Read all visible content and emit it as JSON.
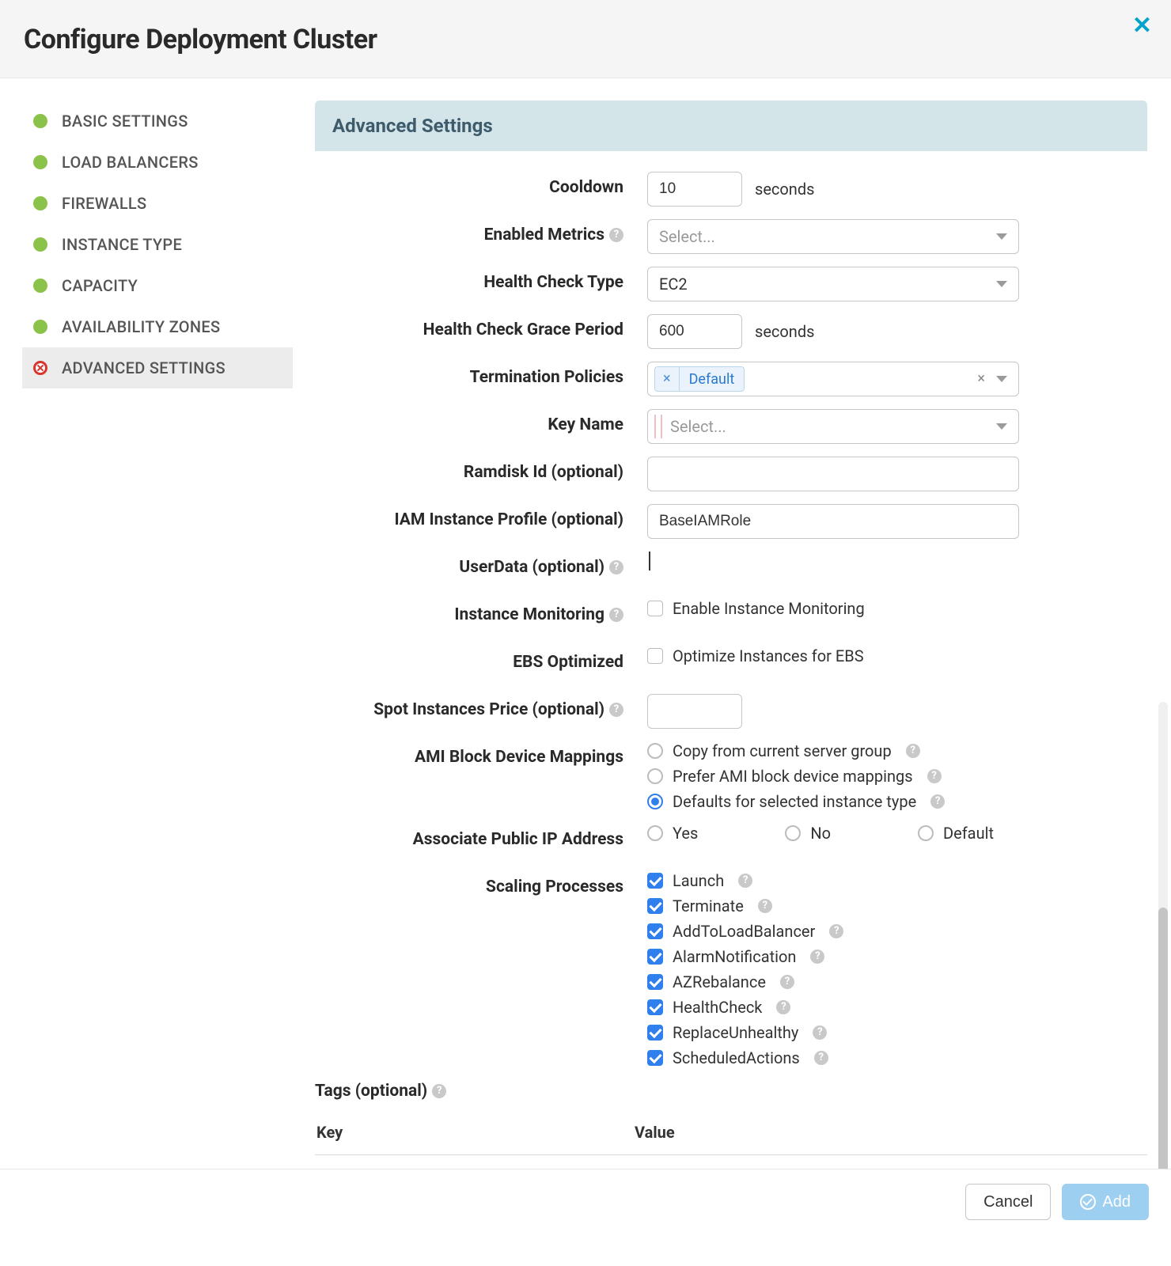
{
  "header": {
    "title": "Configure Deployment Cluster"
  },
  "sidebar": {
    "items": [
      {
        "label": "BASIC SETTINGS",
        "state": "done",
        "id": "basic-settings"
      },
      {
        "label": "LOAD BALANCERS",
        "state": "done",
        "id": "load-balancers"
      },
      {
        "label": "FIREWALLS",
        "state": "done",
        "id": "firewalls"
      },
      {
        "label": "INSTANCE TYPE",
        "state": "done",
        "id": "instance-type"
      },
      {
        "label": "CAPACITY",
        "state": "done",
        "id": "capacity"
      },
      {
        "label": "AVAILABILITY ZONES",
        "state": "done",
        "id": "availability-zones"
      },
      {
        "label": "ADVANCED SETTINGS",
        "state": "error",
        "id": "advanced-settings",
        "active": true
      }
    ]
  },
  "section_title": "Advanced Settings",
  "form": {
    "cooldown": {
      "label": "Cooldown",
      "value": "10",
      "suffix": "seconds"
    },
    "enabled_metrics": {
      "label": "Enabled Metrics",
      "placeholder": "Select..."
    },
    "health_check_type": {
      "label": "Health Check Type",
      "value": "EC2"
    },
    "health_check_grace": {
      "label": "Health Check Grace Period",
      "value": "600",
      "suffix": "seconds"
    },
    "termination_policies": {
      "label": "Termination Policies",
      "tokens": [
        "Default"
      ]
    },
    "key_name": {
      "label": "Key Name",
      "placeholder": "Select..."
    },
    "ramdisk_id": {
      "label": "Ramdisk Id (optional)",
      "value": ""
    },
    "iam_profile": {
      "label": "IAM Instance Profile (optional)",
      "value": "BaseIAMRole"
    },
    "userdata": {
      "label": "UserData (optional)",
      "value": ""
    },
    "instance_monitoring": {
      "label": "Instance Monitoring",
      "checkbox_label": "Enable Instance Monitoring",
      "checked": false
    },
    "ebs_optimized": {
      "label": "EBS Optimized",
      "checkbox_label": "Optimize Instances for EBS",
      "checked": false
    },
    "spot_price": {
      "label": "Spot Instances Price (optional)",
      "value": ""
    },
    "ami_block": {
      "label": "AMI Block Device Mappings",
      "options": [
        "Copy from current server group",
        "Prefer AMI block device mappings",
        "Defaults for selected instance type"
      ],
      "selected_index": 2
    },
    "public_ip": {
      "label": "Associate Public IP Address",
      "options": [
        "Yes",
        "No",
        "Default"
      ],
      "selected_index": -1
    },
    "scaling_processes": {
      "label": "Scaling Processes",
      "options": [
        "Launch",
        "Terminate",
        "AddToLoadBalancer",
        "AlarmNotification",
        "AZRebalance",
        "HealthCheck",
        "ReplaceUnhealthy",
        "ScheduledActions"
      ],
      "checked": [
        true,
        true,
        true,
        true,
        true,
        true,
        true,
        true
      ]
    }
  },
  "tags": {
    "heading": "Tags (optional)",
    "col_key": "Key",
    "col_value": "Value"
  },
  "footer": {
    "cancel": "Cancel",
    "add": "Add"
  }
}
